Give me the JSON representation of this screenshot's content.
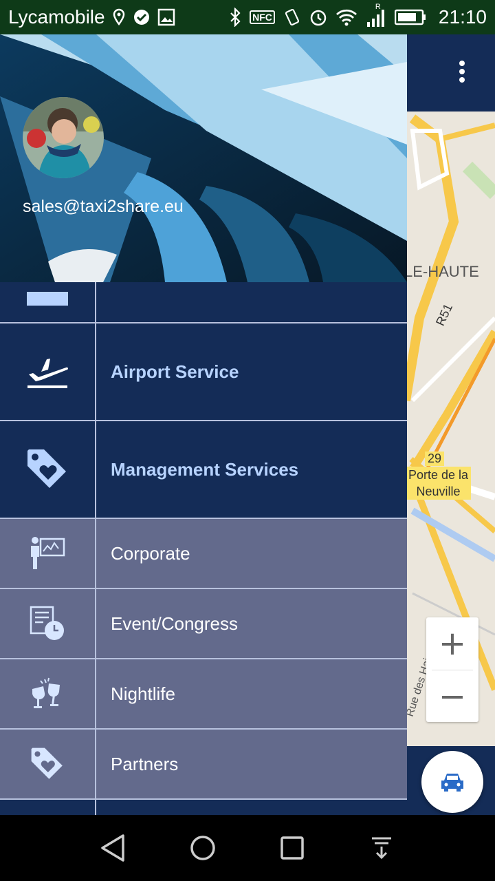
{
  "status_bar": {
    "carrier": "Lycamobile",
    "time": "21:10",
    "nfc": "NFC",
    "signal_type": "R"
  },
  "map": {
    "labels": {
      "area": "LE-HAUTE",
      "road": "R51",
      "exit_number": "29",
      "place_line1": "Porte de la",
      "place_line2": "Neuville",
      "street": "Rue des Haies"
    },
    "zoom_in": "+",
    "zoom_out": "−"
  },
  "drawer": {
    "email": "sales@taxi2share.eu",
    "items": [
      {
        "label": "Airport Service",
        "icon": "airplane-departure-icon"
      },
      {
        "label": "Management Services",
        "icon": "tag-heart-icon"
      },
      {
        "label": "Corporate",
        "icon": "presenter-chart-icon"
      },
      {
        "label": "Event/Congress",
        "icon": "document-clock-icon"
      },
      {
        "label": "Nightlife",
        "icon": "toast-glasses-icon"
      },
      {
        "label": "Partners",
        "icon": "tag-heart-icon"
      }
    ]
  },
  "colors": {
    "appbar": "#142c57",
    "main_item_text": "#b7d3ff",
    "sub_item_bg": "#636a8c",
    "status_bar": "#0e3a18"
  }
}
